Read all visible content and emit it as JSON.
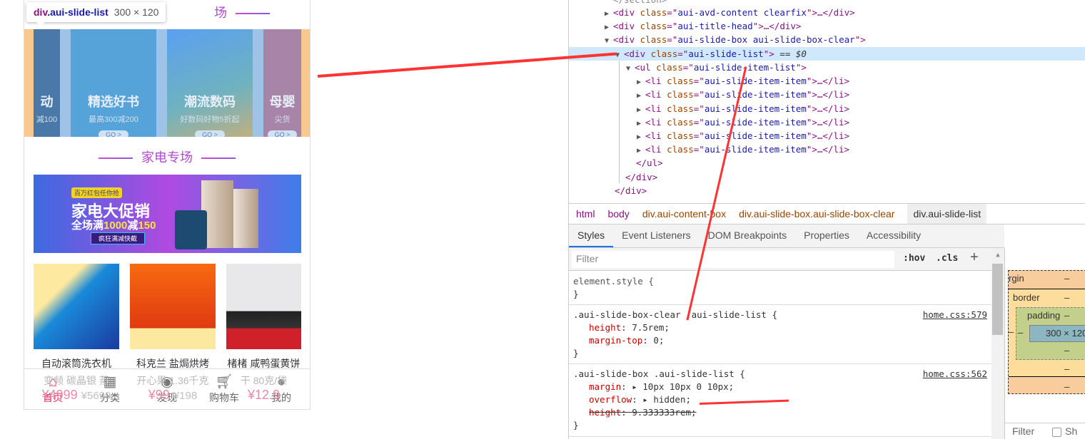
{
  "mobile": {
    "section_title_top": "场",
    "tooltip": {
      "tag": "div",
      "cls": ".aui-slide-list",
      "size": "300 × 120"
    },
    "slides": [
      {
        "title": "动",
        "sub": "减100",
        "go": ""
      },
      {
        "title": "精选好书",
        "sub": "最高300减200",
        "go": "GO >"
      },
      {
        "title": "潮流数码",
        "sub": "好数码好物5折起",
        "go": "GO >"
      },
      {
        "title": "母婴",
        "sub": "尖货",
        "go": "GO >"
      }
    ],
    "section_title": "家电专场",
    "banner": {
      "tag": "百万红包任你抢",
      "headline": "家电大促销",
      "sub_prefix": "全场满",
      "sub_amount": "1000",
      "sub_mid": "减",
      "sub_amount2": "150",
      "button": "疯狂满减快截"
    },
    "products": [
      {
        "name": "自动滚筒洗衣机",
        "desc": "变频 碳晶银 蒸",
        "price": "¥4999",
        "old_price": "¥5699"
      },
      {
        "name": "科克兰 盐焗烘烤",
        "desc": "开心果 1.36千克",
        "price": "¥99",
        "old_price": "¥198"
      },
      {
        "name": "楮楮 咸鸭蛋黄饼",
        "desc": "干 80克/袋",
        "price": "¥12.9",
        "old_price": ""
      }
    ],
    "tabbar": [
      {
        "label": "首页",
        "icon": "home-icon",
        "active": true
      },
      {
        "label": "分类",
        "icon": "grid-icon"
      },
      {
        "label": "发现",
        "icon": "eye-icon"
      },
      {
        "label": "购物车",
        "icon": "cart-icon"
      },
      {
        "label": "我的",
        "icon": "user-icon"
      }
    ]
  },
  "devtools": {
    "dom": {
      "section_close": "</section>",
      "n1_class": "aui-avd-content clearfix",
      "n2_class": "aui-title-head",
      "n3_class": "aui-slide-box aui-slide-box-clear",
      "n4_class": "aui-slide-list",
      "n4_suffix": "== $0",
      "ul_class": "aui-slide-item-list",
      "li_class": "aui-slide-item-item"
    },
    "breadcrumbs": [
      "html",
      "body",
      "div.aui-content-box",
      "div.aui-slide-box.aui-slide-box-clear",
      "div.aui-slide-list"
    ],
    "tabs": [
      "Styles",
      "Event Listeners",
      "DOM Breakpoints",
      "Properties",
      "Accessibility"
    ],
    "filter_placeholder": "Filter",
    "hov": ":hov",
    "cls": ".cls",
    "plus": "+",
    "rules": [
      {
        "selector": "element.style {",
        "source": "",
        "props": []
      },
      {
        "selector": ".aui-slide-box-clear .aui-slide-list {",
        "source": "home.css:579",
        "props": [
          {
            "k": "height",
            "v": "7.5rem;"
          },
          {
            "k": "margin-top",
            "v": "0;"
          }
        ]
      },
      {
        "selector": ".aui-slide-box .aui-slide-list {",
        "source": "home.css:562",
        "props": [
          {
            "k": "margin",
            "v": "▸ 10px 10px 0 10px;"
          },
          {
            "k": "overflow",
            "v": "▸ hidden;"
          },
          {
            "k": "height",
            "v": "9.333333rem;",
            "struck": true
          }
        ]
      }
    ],
    "box_model": {
      "margin": "rgin",
      "border": "border",
      "padding": "padding",
      "content": "300 × 120",
      "dash": "–",
      "filter": "Filter",
      "show_all": "Sh"
    },
    "colors": {
      "selected_row": "#cfe8fc",
      "accent": "#e0245e",
      "annotation_arrow": "#ff3333"
    }
  }
}
